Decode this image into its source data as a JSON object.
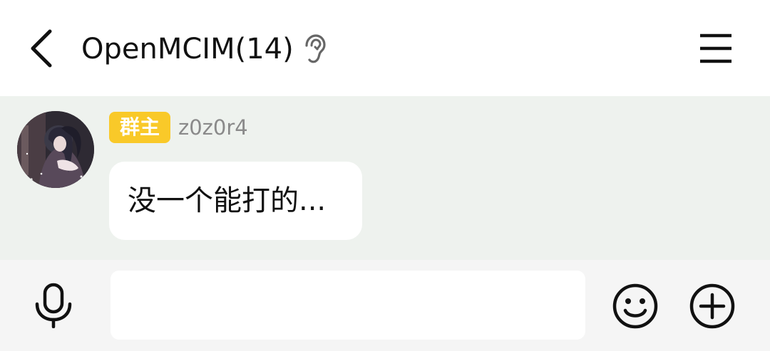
{
  "header": {
    "title": "OpenMCIM(14)",
    "back_icon": "chevron-left-icon",
    "status_icon": "ear-icon",
    "menu_icon": "hamburger-menu-icon"
  },
  "messages": [
    {
      "avatar": "anime-avatar",
      "role_badge": "群主",
      "sender": "z0z0r4",
      "text": "没一个能打的..."
    }
  ],
  "input_bar": {
    "voice_icon": "microphone-icon",
    "value": "",
    "placeholder": "",
    "emoji_icon": "smiley-icon",
    "more_icon": "plus-circle-icon"
  },
  "colors": {
    "chat_background": "#eef2ee",
    "badge": "#f9c929",
    "input_bar": "#f5f5f5"
  }
}
